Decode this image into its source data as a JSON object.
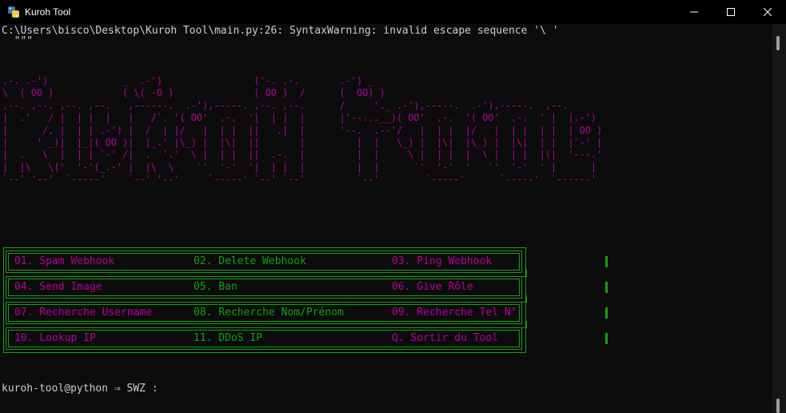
{
  "window": {
    "title": "Kuroh Tool",
    "minimize_icon": "minimize-icon",
    "maximize_icon": "maximize-icon",
    "close_icon": "close-icon"
  },
  "console": {
    "warning_line": "C:\\Users\\bisco\\Desktop\\Kuroh Tool\\main.py:26: SyntaxWarning: invalid escape sequence '\\ '",
    "warning_line2": "  \"\"\"",
    "banner": [
      ".-. .-')             _  .-')                ('-. .-.       .-') _",
      "\\  ( OO )            ( \\( -O )              ( OO )  /      (  OO) )",
      ",--. ,--. ,--. ,--.   ,------.  .-'),-----. ,--. ,--.      /     '._ .-'),-----.  .-'),-----.  ,--.",
      "|  .'   / |  | |  |   |   /`. '( OO'  .-.  '|  | |  |      |'--...__)( OO'  .-.  '( OO'  .-.  ' |  |.-')",
      "|      /, |  | | .-') |  /  | |/   |  | |  ||   .|  |      '--.  .--'/   |  | |  |/   |  | |  | |  | OO )",
      "|     ' _)|  |_|( OO )|  |_.' |\\_) |  |\\|  ||       |         |  |   \\_) |  |\\|  |\\_) |  |\\|  | |  |`-' |",
      "|  .   \\  |  | | `-' /|  .  '.'  \\ |  | |  ||  .-.  |         |  |     \\ |  | |  |  \\ |  | |  |(|  '---.'",
      "|  |\\   \\('  '-'(_.-' |  |\\  \\    `'  '-'  '|  | |  |         |  |      `'  '-'  '   `'  '-'  ' |      |",
      "`--' '--'  `-----'    `--' '--'     `-----' `--' `--'         `--'        `-----'      `-----'  `------'"
    ],
    "prompt": "kuroh-tool@python ⇒ SWZ :"
  },
  "menu": {
    "rows": [
      [
        "01. Spam Webhook",
        "02. Delete Webhook",
        "03. Ping Webhook"
      ],
      [
        "04. Send Image",
        "05. Ban",
        "06. Give Rôle"
      ],
      [
        "07. Recherche Username",
        "08. Recherche Nom/Prénom",
        "09. Recherche Tel N°"
      ],
      [
        "10. Lookup IP",
        "11. DDoS IP",
        "Q. Sortir du Tool"
      ]
    ]
  },
  "colors": {
    "background": "#0c0c0c",
    "magenta": "#b4009e",
    "green": "#13a10e",
    "text": "#cccccc"
  }
}
